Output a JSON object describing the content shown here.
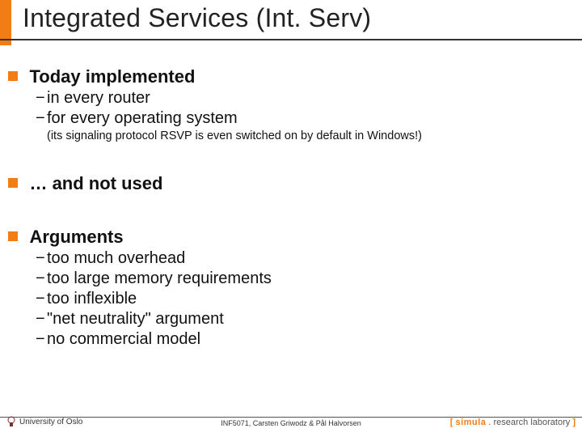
{
  "title": "Integrated Services (Int. Serv)",
  "sections": [
    {
      "heading": "Today implemented",
      "items": [
        "in every router",
        "for every operating system"
      ],
      "paren": "(its signaling protocol RSVP is even switched on by default in Windows!)"
    },
    {
      "heading": "… and not used",
      "items": []
    },
    {
      "heading": "Arguments",
      "items": [
        "too much overhead",
        "too large memory requirements",
        "too inflexible",
        "\"net neutrality\" argument",
        "no commercial model"
      ]
    }
  ],
  "footer": {
    "university": "University of Oslo",
    "course": "INF5071, Carsten Griwodz & Pål Halvorsen",
    "lab_bracket_open": "[ ",
    "lab_word": "simula",
    "lab_rest": " . research laboratory ",
    "lab_bracket_close": "]"
  }
}
